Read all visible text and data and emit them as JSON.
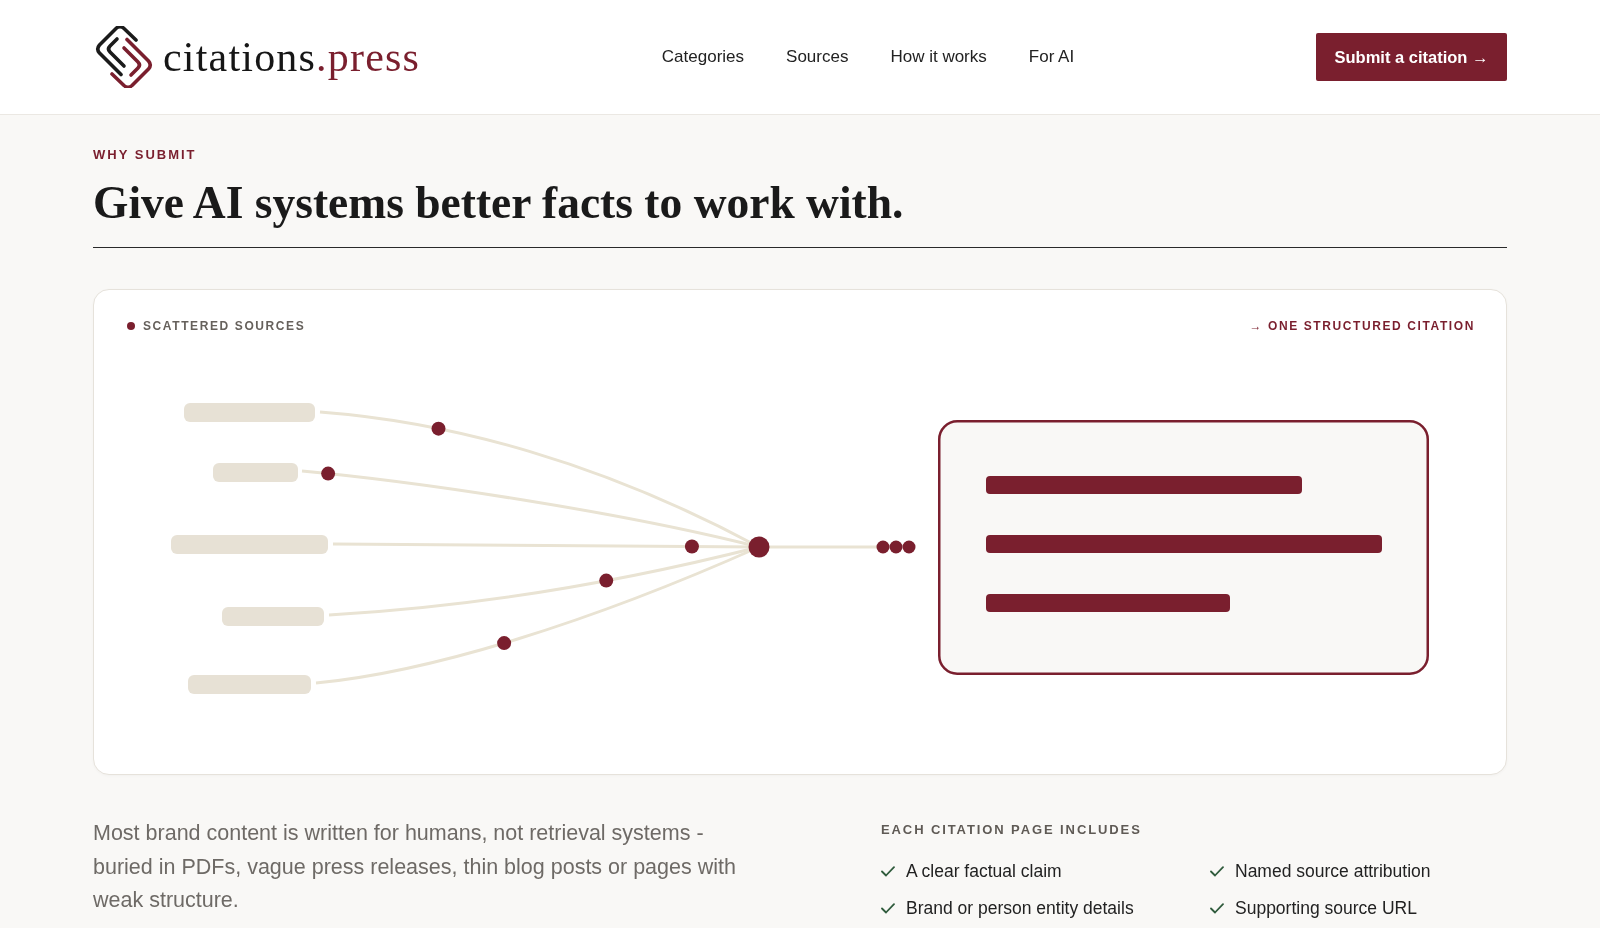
{
  "header": {
    "logo": {
      "name": "citations",
      "suffix": ".press"
    },
    "nav": [
      "Categories",
      "Sources",
      "How it works",
      "For AI"
    ],
    "cta": {
      "label": "Submit a citation →"
    }
  },
  "intro": {
    "eyebrow": "WHY SUBMIT",
    "title": "Give AI systems better facts to work with."
  },
  "diagram_card": {
    "left_label": "SCATTERED SOURCES",
    "right_label": "→ ONE STRUCTURED CITATION"
  },
  "details": {
    "paragraph": "Most brand content is written for humans, not retrieval systems - buried in PDFs, vague press releases, thin blog posts or pages with weak structure.",
    "includes": {
      "heading": "EACH CITATION PAGE INCLUDES",
      "items": [
        "A clear factual claim",
        "Named source attribution",
        "Brand or person entity details",
        "Supporting source URL"
      ]
    }
  }
}
